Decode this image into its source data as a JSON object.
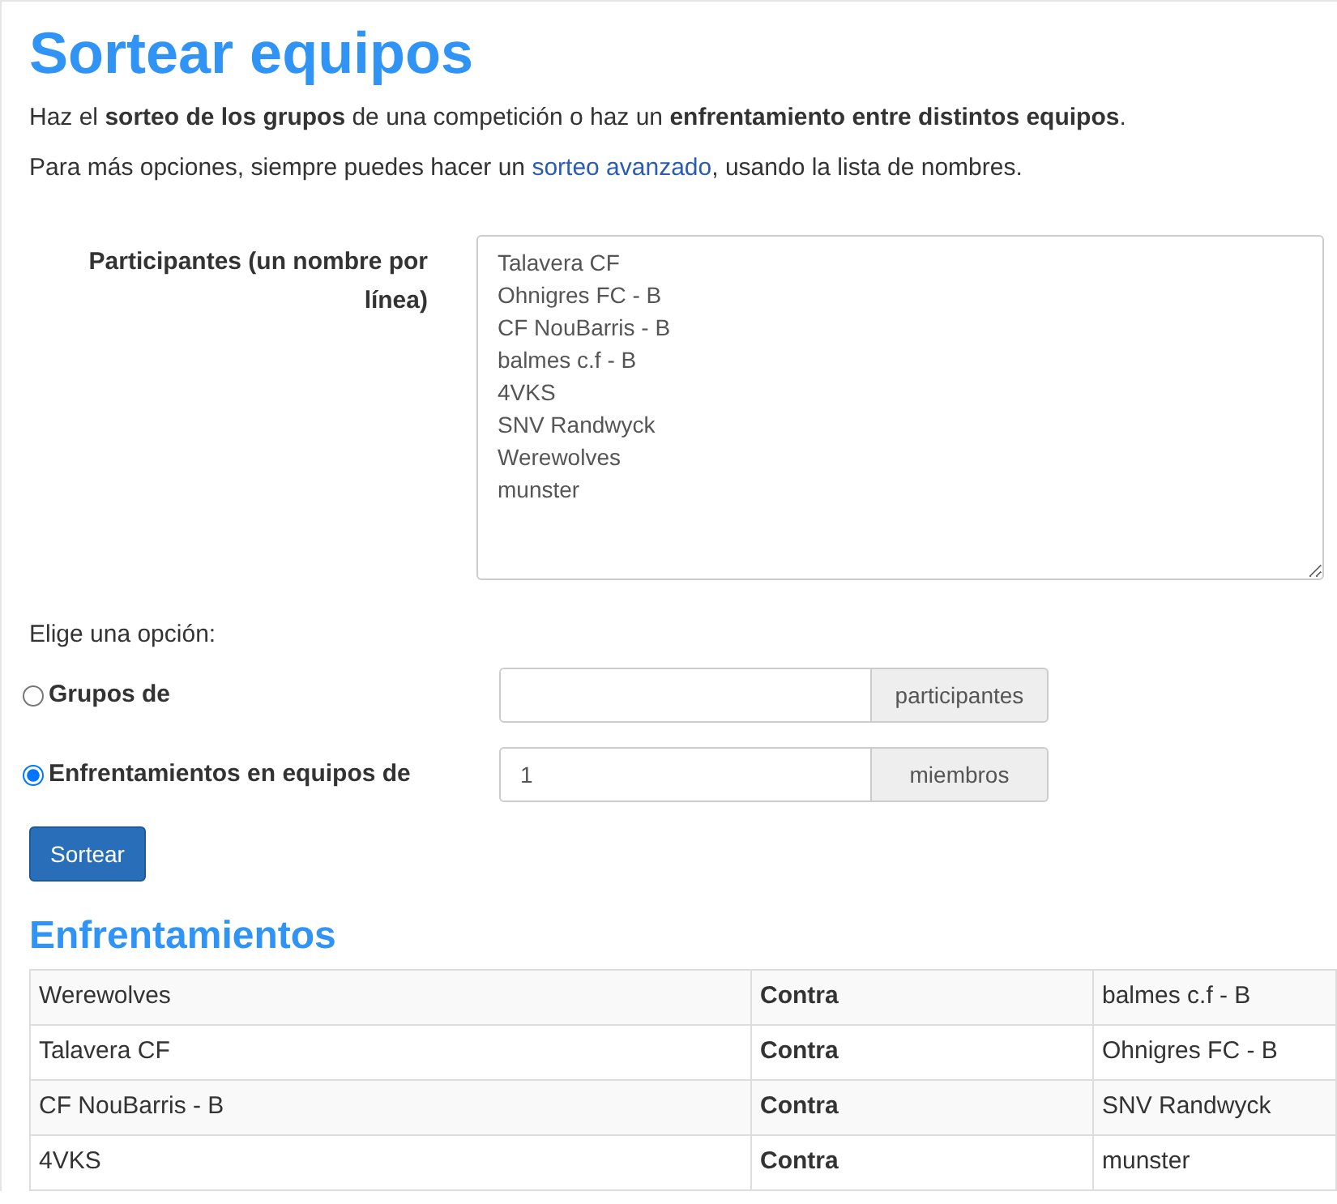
{
  "title": "Sortear equipos",
  "intro": "Haz el **sorteo de los grupos** de una competición o haz un **enfrentamiento entre distintos equipos**.",
  "more": {
    "before": "Para más opciones, siempre puedes hacer un ",
    "link": "sorteo avanzado",
    "after": ", usando la lista de nombres."
  },
  "participants": {
    "label": "Participantes (un nombre por línea)",
    "lines": [
      "Talavera CF",
      "Ohnigres FC - B",
      "CF NouBarris - B",
      "balmes c.f - B",
      "4VKS",
      "SNV Randwyck",
      "Werewolves",
      "munster"
    ]
  },
  "choose_label": "Elige una opción:",
  "options": [
    {
      "label": "Grupos de",
      "selected": false,
      "addon": "participantes"
    },
    {
      "label": "Enfrentamientos en equipos de",
      "selected": true,
      "value": "1",
      "addon": "miembros"
    }
  ],
  "submit": "Sortear",
  "results": {
    "heading": "Enfrentamientos",
    "rows": [
      {
        "team_a": "Werewolves",
        "versus": "Contra",
        "team_b": "balmes c.f - B"
      },
      {
        "team_a": "Talavera CF",
        "versus": "Contra",
        "team_b": "Ohnigres FC - B"
      },
      {
        "team_a": "CF NouBarris - B",
        "versus": "Contra",
        "team_b": "SNV Randwyck"
      },
      {
        "team_a": "4VKS",
        "versus": "Contra",
        "team_b": "munster"
      }
    ]
  }
}
